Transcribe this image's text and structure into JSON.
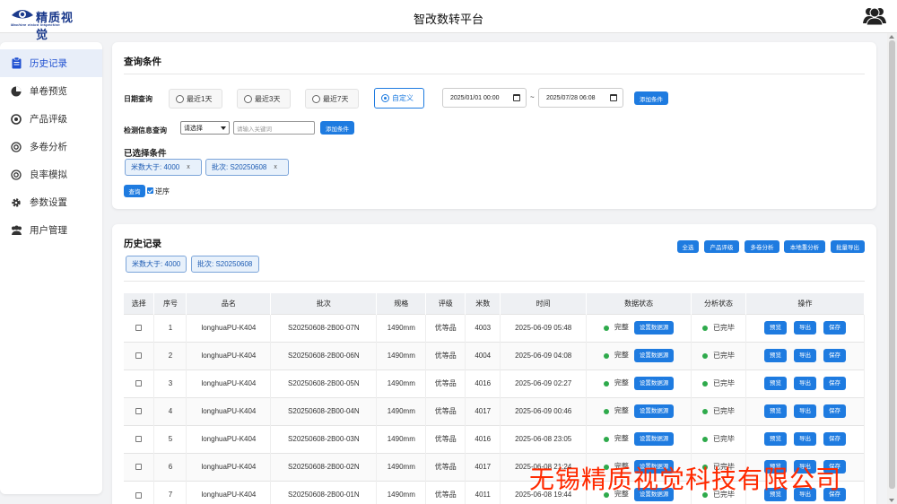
{
  "header": {
    "logo_text": "精质视觉",
    "logo_subtext": "Machine vision inspection",
    "title": "智改数转平台",
    "user_icon": "users-icon"
  },
  "sidebar": {
    "items": [
      {
        "label": "历史记录",
        "icon": "clipboard-icon",
        "active": true
      },
      {
        "label": "单卷预览",
        "icon": "pie-chart-icon",
        "active": false
      },
      {
        "label": "产品评级",
        "icon": "target-icon",
        "active": false
      },
      {
        "label": "多卷分析",
        "icon": "target-icon",
        "active": false
      },
      {
        "label": "良率模拟",
        "icon": "target-icon",
        "active": false
      },
      {
        "label": "参数设置",
        "icon": "gear-icon",
        "active": false
      },
      {
        "label": "用户管理",
        "icon": "users-icon",
        "active": false
      }
    ]
  },
  "query": {
    "title": "查询条件",
    "date_label": "日期查询",
    "date_options": [
      "最近1天",
      "最近3天",
      "最近7天",
      "自定义"
    ],
    "date_selected": "自定义",
    "start_date": "2025/01/01 00:00",
    "end_date": "2025/07/28 06:08",
    "range_sep": "~",
    "add_condition": "添加条件",
    "detect_label": "检测信息查询",
    "select_value": "请选择",
    "keyword_placeholder": "请输入关键词",
    "add_condition2": "添加条件",
    "selected_label": "已选择条件",
    "tags": [
      "米数大于: 4000",
      "批次: S20250608"
    ],
    "tag_close": "x",
    "search_btn": "查询",
    "reverse_label": "逆序",
    "reverse_checked": true
  },
  "history": {
    "title": "历史记录",
    "buttons": [
      "全选",
      "产品评级",
      "多卷分析",
      "本地重分析",
      "批量导出"
    ],
    "tags": [
      "米数大于: 4000",
      "批次: S20250608"
    ],
    "columns": [
      "选择",
      "序号",
      "品名",
      "批次",
      "规格",
      "评级",
      "米数",
      "时间",
      "数据状态",
      "分析状态",
      "操作"
    ],
    "rows": [
      {
        "no": "1",
        "name": "longhuaPU-K404",
        "batch": "S20250608-2B00-07N",
        "spec": "1490mm",
        "grade": "优等品",
        "meters": "4003",
        "time": "2025-06-09 05:48",
        "data_status": "完整",
        "analysis": "已完毕"
      },
      {
        "no": "2",
        "name": "longhuaPU-K404",
        "batch": "S20250608-2B00-06N",
        "spec": "1490mm",
        "grade": "优等品",
        "meters": "4004",
        "time": "2025-06-09 04:08",
        "data_status": "完整",
        "analysis": "已完毕"
      },
      {
        "no": "3",
        "name": "longhuaPU-K404",
        "batch": "S20250608-2B00-05N",
        "spec": "1490mm",
        "grade": "优等品",
        "meters": "4016",
        "time": "2025-06-09 02:27",
        "data_status": "完整",
        "analysis": "已完毕"
      },
      {
        "no": "4",
        "name": "longhuaPU-K404",
        "batch": "S20250608-2B00-04N",
        "spec": "1490mm",
        "grade": "优等品",
        "meters": "4017",
        "time": "2025-06-09 00:46",
        "data_status": "完整",
        "analysis": "已完毕"
      },
      {
        "no": "5",
        "name": "longhuaPU-K404",
        "batch": "S20250608-2B00-03N",
        "spec": "1490mm",
        "grade": "优等品",
        "meters": "4016",
        "time": "2025-06-08 23:05",
        "data_status": "完整",
        "analysis": "已完毕"
      },
      {
        "no": "6",
        "name": "longhuaPU-K404",
        "batch": "S20250608-2B00-02N",
        "spec": "1490mm",
        "grade": "优等品",
        "meters": "4017",
        "time": "2025-06-08 21:24",
        "data_status": "完整",
        "analysis": "已完毕"
      },
      {
        "no": "7",
        "name": "longhuaPU-K404",
        "batch": "S20250608-2B00-01N",
        "spec": "1490mm",
        "grade": "优等品",
        "meters": "4011",
        "time": "2025-06-08 19:44",
        "data_status": "完整",
        "analysis": "已完毕"
      }
    ],
    "set_source_btn": "设置数据源",
    "preview_btn": "预览",
    "export_btn": "导出",
    "save_btn": "保存"
  },
  "watermark": "无锡精质视觉科技有限公司",
  "colors": {
    "accent": "#1e7be0",
    "ok": "#2eaa4b",
    "watermark": "#ff2a00"
  }
}
